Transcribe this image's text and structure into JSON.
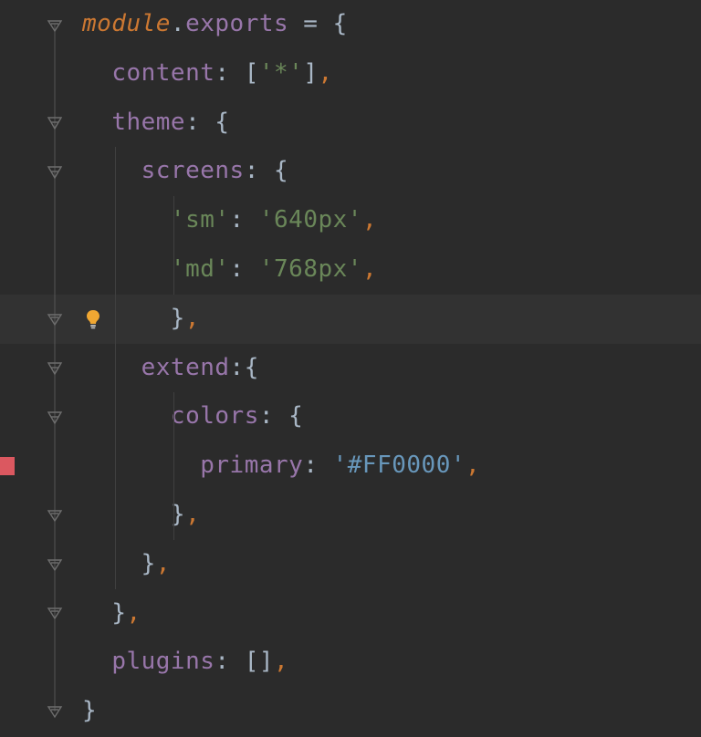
{
  "tokens": {
    "module": "module",
    "dot": ".",
    "exports": "exports",
    "eq": " = ",
    "lbrace": "{",
    "rbrace": "}",
    "lbracket": "[",
    "rbracket": "]",
    "colon": ": ",
    "colon_tight": ":",
    "comma": ",",
    "content": "content",
    "theme": "theme",
    "screens": "screens",
    "extend": "extend",
    "colors": "colors",
    "primary": "primary",
    "plugins": "plugins",
    "star": "'*'",
    "sm_key": "'sm'",
    "sm_val": "'640px'",
    "md_key": "'md'",
    "md_val": "'768px'",
    "hex": "'#FF0000'"
  }
}
